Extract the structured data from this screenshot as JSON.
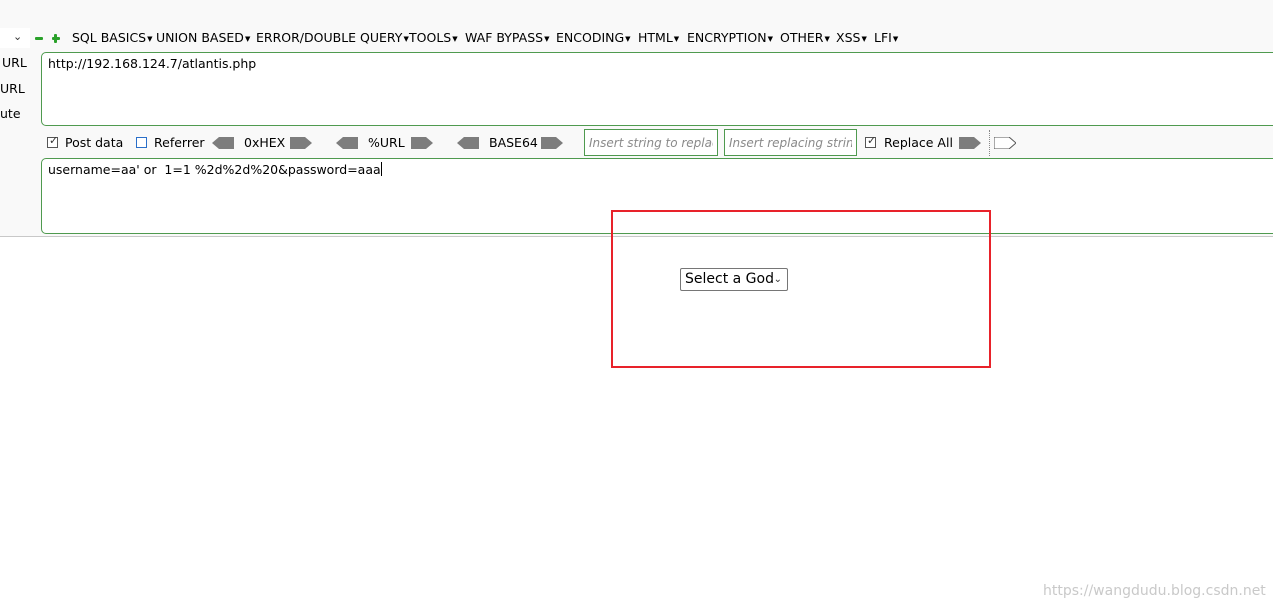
{
  "toolbar": {
    "dropdown_chevron": "chevron-down-icon",
    "minus_icon": "minus-icon",
    "plus_icon": "plus-icon",
    "menus": [
      "SQL BASICS",
      "UNION BASED",
      "ERROR/DOUBLE QUERY",
      "TOOLS",
      "WAF BYPASS",
      "ENCODING",
      "HTML",
      "ENCRYPTION",
      "OTHER",
      "XSS",
      "LFI"
    ]
  },
  "side_labels": {
    "load": "URL",
    "split": "URL",
    "execute": "ute"
  },
  "url_field": {
    "value": "http://192.168.124.7/atlantis.php"
  },
  "options": {
    "post_data_label": "Post data",
    "post_data_checked": true,
    "referrer_label": "Referrer",
    "referrer_checked": false,
    "hex_label": "0xHEX",
    "url_label": "%URL",
    "base64_label": "BASE64",
    "replace_from_placeholder": "Insert string to replace",
    "replace_to_placeholder": "Insert replacing string",
    "replace_all_label": "Replace All",
    "replace_all_checked": true
  },
  "post_field": {
    "value": "username=aa' or  1=1 %2d%2d%20&password=aaa"
  },
  "page": {
    "select_value": "Select a God"
  },
  "colors": {
    "accent_green": "#4f9a4f",
    "highlight_red": "#e8222a",
    "checkbox_blue": "#2a6fc9"
  },
  "watermark": "https://wangdudu.blog.csdn.net"
}
